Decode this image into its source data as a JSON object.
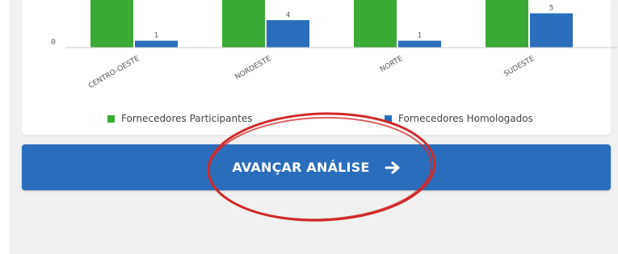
{
  "chart_data": {
    "type": "bar",
    "categories": [
      "CENTRO-OESTE",
      "NORDESTE",
      "NORTE",
      "SUDESTE"
    ],
    "series": [
      {
        "name": "Fornecedores Participantes",
        "color": "#3aaa35",
        "values": [
          null,
          null,
          null,
          null
        ]
      },
      {
        "name": "Fornecedores Homologados",
        "color": "#2a6ebb",
        "values": [
          1,
          4,
          1,
          5
        ]
      }
    ],
    "data_labels": [
      "1",
      "4",
      "1",
      "5"
    ],
    "y_tick_labels": [
      "0"
    ],
    "ylim": [
      0,
      8
    ],
    "legend_position": "bottom",
    "grid": false
  },
  "cta": {
    "label": "AVANÇAR ANÁLISE",
    "icon": "arrow-right-icon",
    "color": "#2a6ebb"
  },
  "annotation": {
    "shape": "ellipse",
    "color": "#d02a2a"
  }
}
